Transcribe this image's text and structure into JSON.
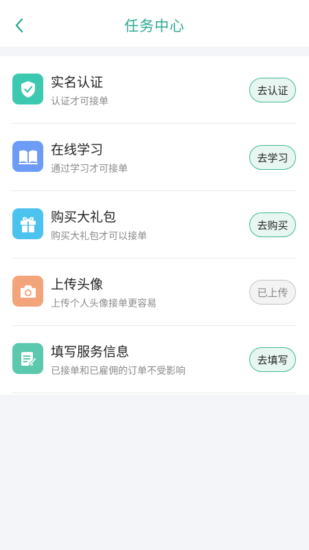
{
  "header": {
    "title": "任务中心"
  },
  "tasks": [
    {
      "title": "实名认证",
      "subtitle": "认证才可接单",
      "action": "去认证",
      "icon": "shield-check-icon",
      "color": "#3dc9b0",
      "done": false
    },
    {
      "title": "在线学习",
      "subtitle": "通过学习才可接单",
      "action": "去学习",
      "icon": "book-icon",
      "color": "#6d9cf6",
      "done": false
    },
    {
      "title": "购买大礼包",
      "subtitle": "购买大礼包才可以接单",
      "action": "去购买",
      "icon": "gift-icon",
      "color": "#4cc2ee",
      "done": false
    },
    {
      "title": "上传头像",
      "subtitle": "上传个人头像接单更容易",
      "action": "已上传",
      "icon": "camera-icon",
      "color": "#f4a47b",
      "done": true
    },
    {
      "title": "填写服务信息",
      "subtitle": "已接单和已雇佣的订单不受影响",
      "action": "去填写",
      "icon": "edit-form-icon",
      "color": "#5cc8ae",
      "done": false
    }
  ]
}
